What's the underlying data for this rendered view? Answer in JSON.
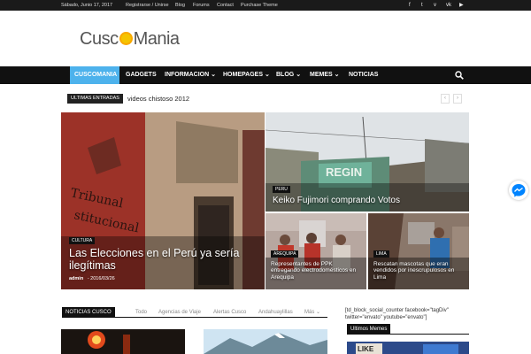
{
  "topbar": {
    "date": "Sábado, Junio 17, 2017",
    "links": [
      "Registrarse / Unirse",
      "Blog",
      "Forums",
      "Contact",
      "Purchase Theme"
    ],
    "social_icons": [
      "facebook-icon",
      "twitter-icon",
      "vimeo-icon",
      "vk-icon",
      "youtube-icon"
    ]
  },
  "logo": {
    "left": "Cusc",
    "right": "Mania"
  },
  "nav": {
    "items": [
      "CUSCOMANIA",
      "GADGETS",
      "INFORMACION",
      "HOMEPAGES",
      "BLOG",
      "MEMES",
      "NOTICIAS"
    ]
  },
  "ticker": {
    "label": "ULTIMAS ENTRADAS",
    "text": "videos chistoso 2012"
  },
  "featured": {
    "main": {
      "category": "CULTURA",
      "title": "Las Elecciones en el Perú ya sería ilegítimas",
      "author": "admin",
      "date": "2016/03/26"
    },
    "top_right": {
      "category": "PERU",
      "title": "Keiko Fujimori comprando Votos"
    },
    "bottom_left": {
      "category": "AREQUIPA",
      "title": "Representantes de PPK entregando electrodomésticos en Arequipa"
    },
    "bottom_right": {
      "category": "LIMA",
      "title": "Rescatan mascotas que eran vendidos por inescrupulosos en Lima"
    }
  },
  "section": {
    "label": "NOTICIAS CUSCO",
    "tabs": [
      "Todo",
      "Agencias de Viaje",
      "Alertas Cusco",
      "Andahuaylillas",
      "Más"
    ]
  },
  "sidebar": {
    "shortcode": "[td_block_social_counter facebook=\"tagDiv\" twitter=\"envato\" youtube=\"envato\"]",
    "label": "Ultimos Memes"
  },
  "colors": {
    "accent": "#4db2ec",
    "topbar": "#1a1a1a",
    "nav": "#111111"
  }
}
